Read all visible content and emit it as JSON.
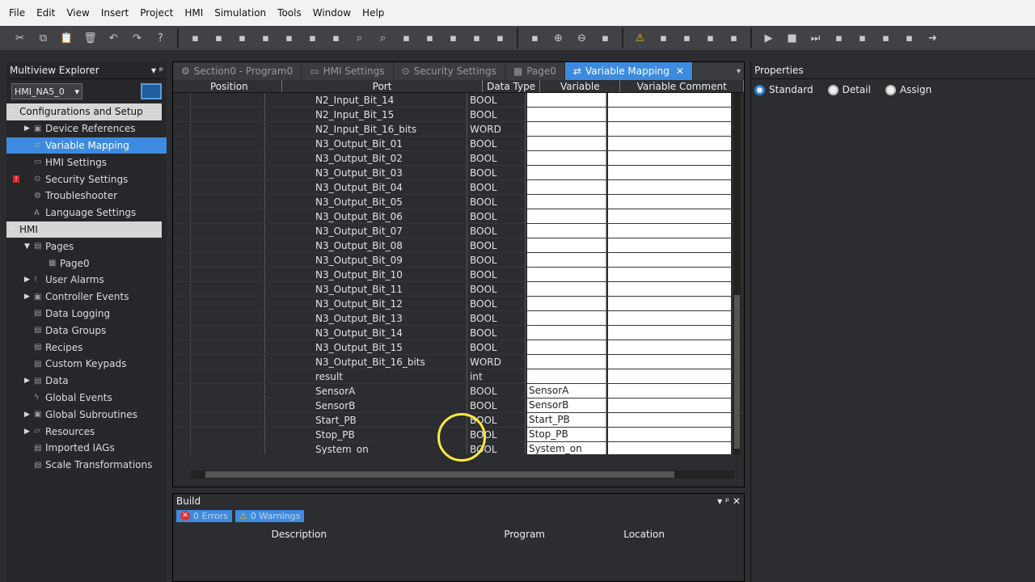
{
  "menu": [
    "File",
    "Edit",
    "View",
    "Insert",
    "Project",
    "HMI",
    "Simulation",
    "Tools",
    "Window",
    "Help"
  ],
  "toolbar": {
    "icons": [
      "cut-icon",
      "copy-icon",
      "paste-icon",
      "delete-icon",
      "undo-icon",
      "redo-icon",
      "help-icon",
      "table-icon",
      "tree-icon",
      "grid-icon",
      "window-icon",
      "layout-icon",
      "settings-icon",
      "tool-icon",
      "find-icon",
      "search-icon",
      "check-icon",
      "list-icon",
      "link-icon",
      "transfer-icon",
      "compile-icon",
      "select-icon",
      "zoom-in-icon",
      "zoom-out-icon",
      "hand-icon",
      "warning-icon",
      "filter-icon",
      "refresh-icon",
      "map-icon",
      "stack-icon",
      "run-icon",
      "stop-icon",
      "step-icon",
      "pause-icon",
      "breakpoint-icon",
      "grab-icon",
      "hand-cursor-icon",
      "forward-icon"
    ]
  },
  "explorer": {
    "title": "Multiview Explorer",
    "pin": "▾ ᵖ",
    "device": "HMI_NA5_0",
    "items": [
      {
        "label": "Configurations and Setup",
        "level": 0,
        "arrow": "▼",
        "type": "header"
      },
      {
        "label": "Device References",
        "level": 1,
        "arrow": "▶",
        "icon": "▣"
      },
      {
        "label": "Variable Mapping",
        "level": 1,
        "arrow": "",
        "icon": "⇄",
        "selected": true
      },
      {
        "label": "HMI Settings",
        "level": 1,
        "arrow": "",
        "icon": "▭"
      },
      {
        "label": "Security Settings",
        "level": 1,
        "arrow": "",
        "icon": "⊙",
        "error": true
      },
      {
        "label": "Troubleshooter",
        "level": 1,
        "arrow": "",
        "icon": "⚙"
      },
      {
        "label": "Language Settings",
        "level": 1,
        "arrow": "",
        "icon": "A"
      },
      {
        "label": "HMI",
        "level": 0,
        "arrow": "▼",
        "type": "header"
      },
      {
        "label": "Pages",
        "level": 1,
        "arrow": "▼",
        "icon": "▤"
      },
      {
        "label": "Page0",
        "level": 2,
        "arrow": "",
        "icon": "▦"
      },
      {
        "label": "User Alarms",
        "level": 1,
        "arrow": "▶",
        "icon": "!"
      },
      {
        "label": "Controller Events",
        "level": 1,
        "arrow": "▶",
        "icon": "▣"
      },
      {
        "label": "Data Logging",
        "level": 1,
        "arrow": "",
        "icon": "▤"
      },
      {
        "label": "Data Groups",
        "level": 1,
        "arrow": "",
        "icon": "▤"
      },
      {
        "label": "Recipes",
        "level": 1,
        "arrow": "",
        "icon": "▤"
      },
      {
        "label": "Custom Keypads",
        "level": 1,
        "arrow": "",
        "icon": "▤"
      },
      {
        "label": "Data",
        "level": 1,
        "arrow": "▶",
        "icon": "▤"
      },
      {
        "label": "Global Events",
        "level": 1,
        "arrow": "",
        "icon": "ϟ"
      },
      {
        "label": "Global Subroutines",
        "level": 1,
        "arrow": "▶",
        "icon": "▣"
      },
      {
        "label": "Resources",
        "level": 1,
        "arrow": "▶",
        "icon": "▱"
      },
      {
        "label": "Imported IAGs",
        "level": 1,
        "arrow": "",
        "icon": "▤"
      },
      {
        "label": "Scale Transformations",
        "level": 1,
        "arrow": "",
        "icon": "▤"
      }
    ]
  },
  "editor": {
    "tabs": [
      {
        "label": "Section0 - Program0",
        "icon": "⚙"
      },
      {
        "label": "HMI Settings",
        "icon": "▭"
      },
      {
        "label": "Security Settings",
        "icon": "⊙"
      },
      {
        "label": "Page0",
        "icon": "▦"
      },
      {
        "label": "Variable Mapping",
        "icon": "⇄",
        "active": true,
        "close": "✕"
      }
    ],
    "columns": [
      "Position",
      "Port",
      "Data Type",
      "Variable",
      "Variable Comment"
    ],
    "rows": [
      {
        "port": "N2_Input_Bit_14",
        "type": "BOOL",
        "variable": ""
      },
      {
        "port": "N2_Input_Bit_15",
        "type": "BOOL",
        "variable": ""
      },
      {
        "port": "N2_Input_Bit_16_bits",
        "type": "WORD",
        "variable": ""
      },
      {
        "port": "N3_Output_Bit_01",
        "type": "BOOL",
        "variable": ""
      },
      {
        "port": "N3_Output_Bit_02",
        "type": "BOOL",
        "variable": ""
      },
      {
        "port": "N3_Output_Bit_03",
        "type": "BOOL",
        "variable": ""
      },
      {
        "port": "N3_Output_Bit_04",
        "type": "BOOL",
        "variable": ""
      },
      {
        "port": "N3_Output_Bit_05",
        "type": "BOOL",
        "variable": ""
      },
      {
        "port": "N3_Output_Bit_06",
        "type": "BOOL",
        "variable": ""
      },
      {
        "port": "N3_Output_Bit_07",
        "type": "BOOL",
        "variable": ""
      },
      {
        "port": "N3_Output_Bit_08",
        "type": "BOOL",
        "variable": ""
      },
      {
        "port": "N3_Output_Bit_09",
        "type": "BOOL",
        "variable": ""
      },
      {
        "port": "N3_Output_Bit_10",
        "type": "BOOL",
        "variable": ""
      },
      {
        "port": "N3_Output_Bit_11",
        "type": "BOOL",
        "variable": ""
      },
      {
        "port": "N3_Output_Bit_12",
        "type": "BOOL",
        "variable": ""
      },
      {
        "port": "N3_Output_Bit_13",
        "type": "BOOL",
        "variable": ""
      },
      {
        "port": "N3_Output_Bit_14",
        "type": "BOOL",
        "variable": ""
      },
      {
        "port": "N3_Output_Bit_15",
        "type": "BOOL",
        "variable": ""
      },
      {
        "port": "N3_Output_Bit_16_bits",
        "type": "WORD",
        "variable": ""
      },
      {
        "port": "result",
        "type": "int",
        "variable": ""
      },
      {
        "port": "SensorA",
        "type": "BOOL",
        "variable": "SensorA"
      },
      {
        "port": "SensorB",
        "type": "BOOL",
        "variable": "SensorB"
      },
      {
        "port": "Start_PB",
        "type": "BOOL",
        "variable": "Start_PB"
      },
      {
        "port": "Stop_PB",
        "type": "BOOL",
        "variable": "Stop_PB"
      },
      {
        "port": "System_on",
        "type": "BOOL",
        "variable": "System_on"
      }
    ]
  },
  "build": {
    "title": "Build",
    "errors": "0 Errors",
    "warnings": "0 Warnings",
    "columns": [
      "Description",
      "Program",
      "Location"
    ],
    "controls": "▾ ᵖ ✕"
  },
  "properties": {
    "title": "Properties",
    "options": [
      {
        "label": "Standard",
        "selected": true
      },
      {
        "label": "Detail",
        "selected": false
      },
      {
        "label": "Assign",
        "selected": false
      }
    ]
  },
  "colors": {
    "accent": "#3d8be0",
    "panel": "#2b2d30",
    "highlight_ring": "#ffea3b"
  }
}
